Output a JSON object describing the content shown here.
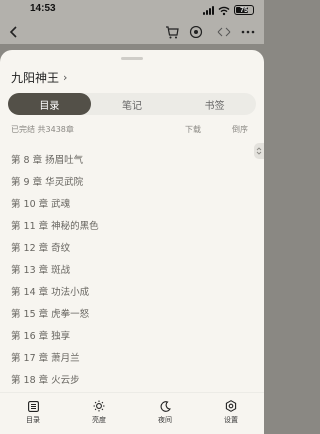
{
  "status_bar": {
    "time": "14:53",
    "battery_label": "75",
    "battery_level": 0.75,
    "icons": [
      "signal-icon",
      "wifi-icon",
      "battery-icon"
    ]
  },
  "top_nav": {
    "icons": [
      "back-icon",
      "cart-icon",
      "eye-icon",
      "more-icon"
    ]
  },
  "book": {
    "title": "九阳神王",
    "chevron": "›"
  },
  "tabs": [
    {
      "label": "目录",
      "active": true
    },
    {
      "label": "笔记",
      "active": false
    },
    {
      "label": "书签",
      "active": false
    }
  ],
  "info": {
    "status": "已完结 共3438章",
    "download": "下载",
    "reverse": "倒序"
  },
  "chapters": [
    "第 8 章  扬眉吐气",
    "第 9 章  华灵武院",
    "第 10 章  武魂",
    "第 11 章  神秘的黑色",
    "第 12 章  奇纹",
    "第 13 章  斑战",
    "第 14 章  功法小成",
    "第 15 章  虎拳一怒",
    "第 16 章  独享",
    "第 17 章  萧月兰",
    "第 18 章  火云步"
  ],
  "toolbar": [
    {
      "label": "目录",
      "icon": "catalog-icon"
    },
    {
      "label": "亮度",
      "icon": "brightness-icon"
    },
    {
      "label": "夜间",
      "icon": "moon-icon"
    },
    {
      "label": "设置",
      "icon": "settings-icon"
    }
  ],
  "colors": {
    "active_tab": "#535048",
    "sheet_bg": "#f7f5f0",
    "overlay": "#8a8883"
  }
}
